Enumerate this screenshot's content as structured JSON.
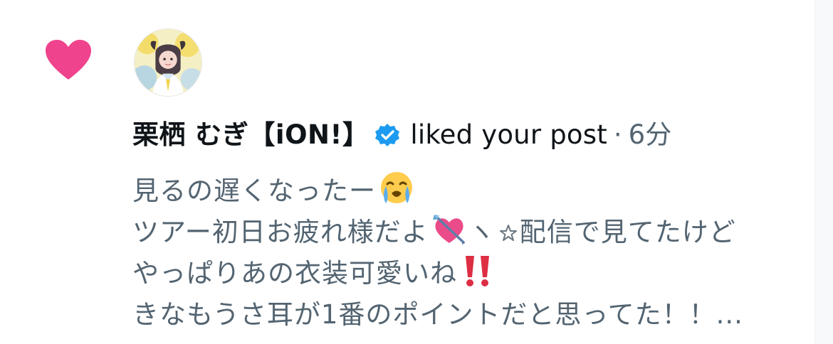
{
  "notification": {
    "type_icon": "heart-icon",
    "avatar_icon": "user-avatar",
    "verified_icon": "verified-badge-icon",
    "colors": {
      "heart": "#f0438e",
      "verified": "#1d9bf0",
      "text_primary": "#0f1419",
      "text_secondary": "#536471"
    },
    "user": {
      "name": "栗栖 むぎ【iON!】"
    },
    "action": "liked your post",
    "separator": "·",
    "time": "6分",
    "post": {
      "line_1": "見るの遅くなったー",
      "line_1_emoji": "loudly-crying-face-icon",
      "line_2_part_1": "ツアー初日お疲れ様だよ",
      "line_2_emoji": "heart-with-arrow-icon",
      "line_2_symbol": "ヽ",
      "line_2_star": "star-icon",
      "line_2_part_2": "配信で見てたけど",
      "line_3": "やっぱりあの衣装可愛いね",
      "line_3_emoji": "double-exclamation-icon",
      "line_4": "きなもうさ耳が1番のポイントだと思ってた！！..."
    }
  }
}
